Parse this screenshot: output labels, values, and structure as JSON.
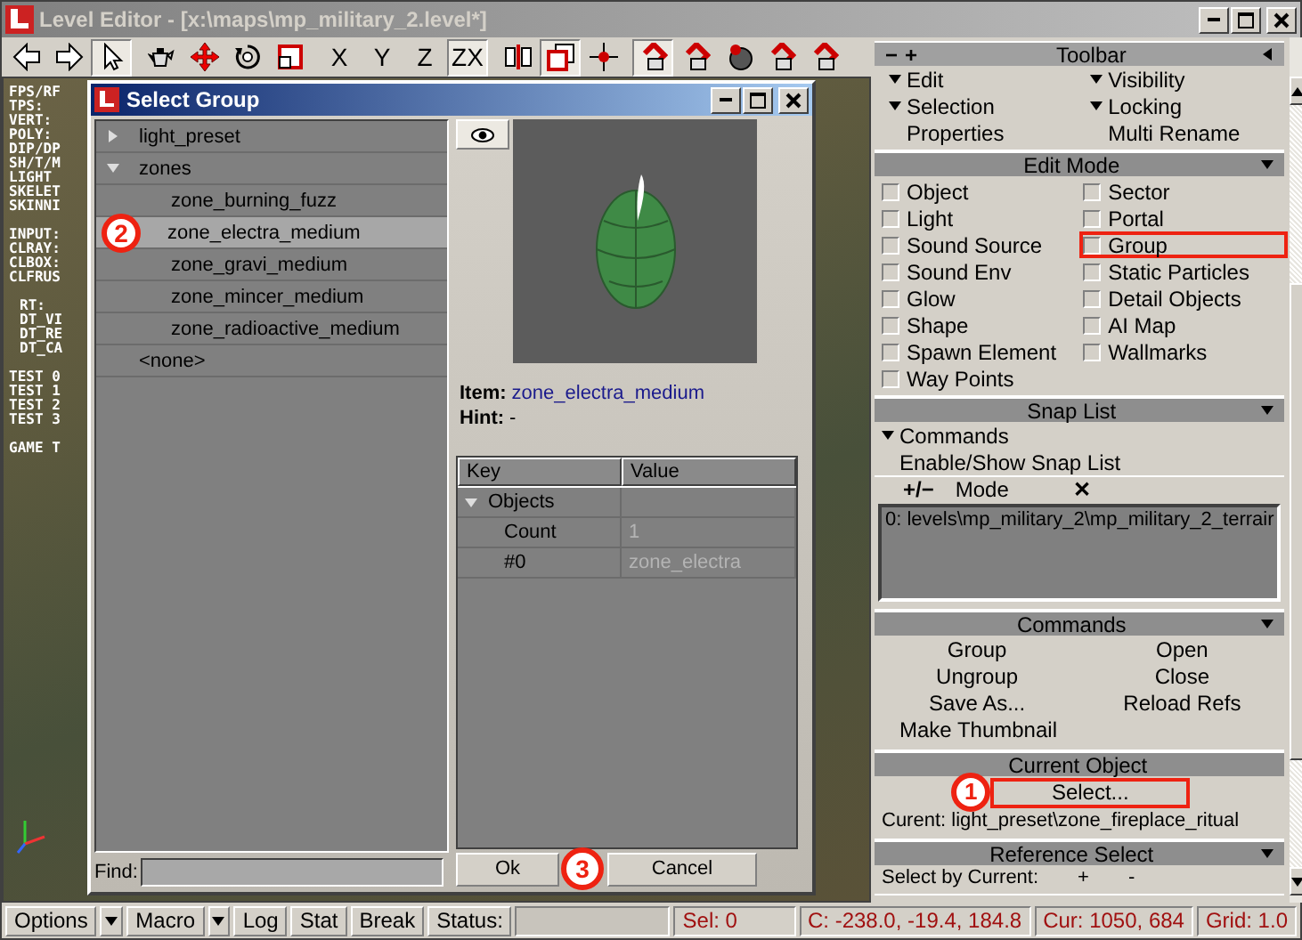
{
  "window": {
    "title": "Level Editor - [x:\\maps\\mp_military_2.level*]"
  },
  "toolbar": [
    {
      "kind": "icon",
      "pressed": false
    },
    {
      "kind": "icon",
      "pressed": false
    },
    {
      "kind": "icon",
      "pressed": true
    },
    {
      "kind": "icon",
      "pressed": false
    },
    {
      "kind": "icon",
      "pressed": false
    },
    {
      "kind": "icon",
      "pressed": false
    },
    {
      "kind": "icon",
      "pressed": false
    },
    {
      "kind": "text",
      "label": "X",
      "pressed": false
    },
    {
      "kind": "text",
      "label": "Y",
      "pressed": false
    },
    {
      "kind": "text",
      "label": "Z",
      "pressed": false
    },
    {
      "kind": "text",
      "label": "ZX",
      "pressed": true
    },
    {
      "kind": "icon",
      "pressed": false
    },
    {
      "kind": "icon",
      "pressed": true
    },
    {
      "kind": "icon",
      "pressed": false
    },
    {
      "kind": "icon",
      "pressed": true
    },
    {
      "kind": "icon",
      "pressed": false
    },
    {
      "kind": "icon",
      "pressed": false
    },
    {
      "kind": "icon",
      "pressed": false
    },
    {
      "kind": "icon",
      "pressed": false
    }
  ],
  "viewport": {
    "stats": [
      {
        "indented": false,
        "lines": [
          "FPS/RF",
          "TPS:",
          "VERT:",
          "POLY:",
          "DIP/DP",
          "SH/T/M",
          "LIGHT",
          "SKELET",
          "SKINNI"
        ]
      },
      {
        "indented": false,
        "lines": [
          "INPUT:",
          "CLRAY:",
          "CLBOX:",
          "CLFRUS"
        ]
      },
      {
        "indented": true,
        "lines": [
          "RT:",
          "DT_VI",
          "DT_RE",
          "DT_CA"
        ]
      },
      {
        "indented": false,
        "lines": [
          "TEST 0",
          "TEST 1",
          "TEST 2",
          "TEST 3"
        ]
      },
      {
        "indented": false,
        "lines": [
          "GAME T"
        ]
      }
    ]
  },
  "dialog": {
    "title": "Select Group",
    "tree": [
      {
        "label": "light_preset",
        "expanded": false,
        "selected": false
      },
      {
        "label": "zones",
        "expanded": true,
        "selected": false,
        "children": [
          {
            "label": "zone_burning_fuzz",
            "selected": false
          },
          {
            "label": "zone_electra_medium",
            "selected": true,
            "callout": "2"
          },
          {
            "label": "zone_gravi_medium",
            "selected": false
          },
          {
            "label": "zone_mincer_medium",
            "selected": false
          },
          {
            "label": "zone_radioactive_medium",
            "selected": false
          }
        ]
      },
      {
        "label": "<none>",
        "selected": false
      }
    ],
    "find_label": "Find:",
    "item_label": "Item:",
    "item_value": "zone_electra_medium",
    "hint_label": "Hint:",
    "hint_value": "-",
    "properties": {
      "columns": [
        "Key",
        "Value"
      ],
      "rows": [
        {
          "key": "Objects",
          "expanded": true,
          "children": [
            {
              "key": "Count",
              "value": "1"
            },
            {
              "key": "#0",
              "value": "zone_electra"
            }
          ]
        }
      ]
    },
    "buttons": [
      {
        "label": "Ok",
        "callout": "3"
      },
      {
        "label": "Cancel"
      }
    ]
  },
  "panel": {
    "title": "Toolbar",
    "header_buttons": [
      "−",
      "+"
    ],
    "sections": [
      {
        "kind": "menu",
        "items": [
          {
            "label": "Edit",
            "has_menu": true
          },
          {
            "label": "Visibility",
            "has_menu": true
          },
          {
            "label": "Selection",
            "has_menu": true
          },
          {
            "label": "Locking",
            "has_menu": true
          },
          {
            "label": "Properties",
            "has_menu": false
          },
          {
            "label": "Multi Rename",
            "has_menu": false
          }
        ]
      },
      {
        "kind": "checkboxes",
        "title": "Edit Mode",
        "items": [
          {
            "label": "Object",
            "checked": false,
            "highlighted": false
          },
          {
            "label": "Sector",
            "checked": false,
            "highlighted": false
          },
          {
            "label": "Light",
            "checked": false,
            "highlighted": false
          },
          {
            "label": "Portal",
            "checked": false,
            "highlighted": false
          },
          {
            "label": "Sound Source",
            "checked": false,
            "highlighted": false
          },
          {
            "label": "Group",
            "checked": false,
            "highlighted": true
          },
          {
            "label": "Sound Env",
            "checked": false,
            "highlighted": false
          },
          {
            "label": "Static Particles",
            "checked": false,
            "highlighted": false
          },
          {
            "label": "Glow",
            "checked": false,
            "highlighted": false
          },
          {
            "label": "Detail Objects",
            "checked": false,
            "highlighted": false
          },
          {
            "label": "Shape",
            "checked": false,
            "highlighted": false
          },
          {
            "label": "AI Map",
            "checked": false,
            "highlighted": false
          },
          {
            "label": "Spawn Element",
            "checked": false,
            "highlighted": false
          },
          {
            "label": "Wallmarks",
            "checked": false,
            "highlighted": false
          },
          {
            "label": "Way Points",
            "checked": false,
            "highlighted": false
          }
        ]
      },
      {
        "kind": "snap",
        "title": "Snap List",
        "items": [
          {
            "label": "Commands",
            "has_menu": true
          },
          {
            "label": "Enable/Show Snap List",
            "has_menu": false
          }
        ],
        "mode_toggle": "+/−",
        "mode_label": "Mode",
        "clear": "✕",
        "list": [
          "0: levels\\mp_military_2\\mp_military_2_terrair"
        ]
      },
      {
        "kind": "commands",
        "title": "Commands",
        "items": [
          "Group",
          "Open",
          "Ungroup",
          "Close",
          "Save As...",
          "Reload Refs",
          "Make Thumbnail"
        ]
      },
      {
        "kind": "current",
        "title": "Current Object",
        "button": {
          "label": "Select...",
          "highlighted": true,
          "callout": "1"
        },
        "current": "Curent: light_preset\\zone_fireplace_ritual"
      },
      {
        "kind": "reference",
        "title": "Reference Select",
        "label": "Select by Current:",
        "buttons": [
          "+",
          "-"
        ]
      }
    ]
  },
  "status_bar": {
    "buttons": [
      {
        "kind": "button",
        "label": "Options"
      },
      {
        "kind": "dropdown"
      },
      {
        "kind": "button",
        "label": "Macro"
      },
      {
        "kind": "dropdown"
      },
      {
        "kind": "button",
        "label": "Log"
      },
      {
        "kind": "button",
        "label": "Stat"
      },
      {
        "kind": "button",
        "label": "Break"
      }
    ],
    "status_label": "Status:",
    "cells": [
      "Sel: 0",
      "C: -238.0, -19.4, 184.8",
      "Cur: 1050, 684",
      "Grid: 1.0"
    ]
  }
}
